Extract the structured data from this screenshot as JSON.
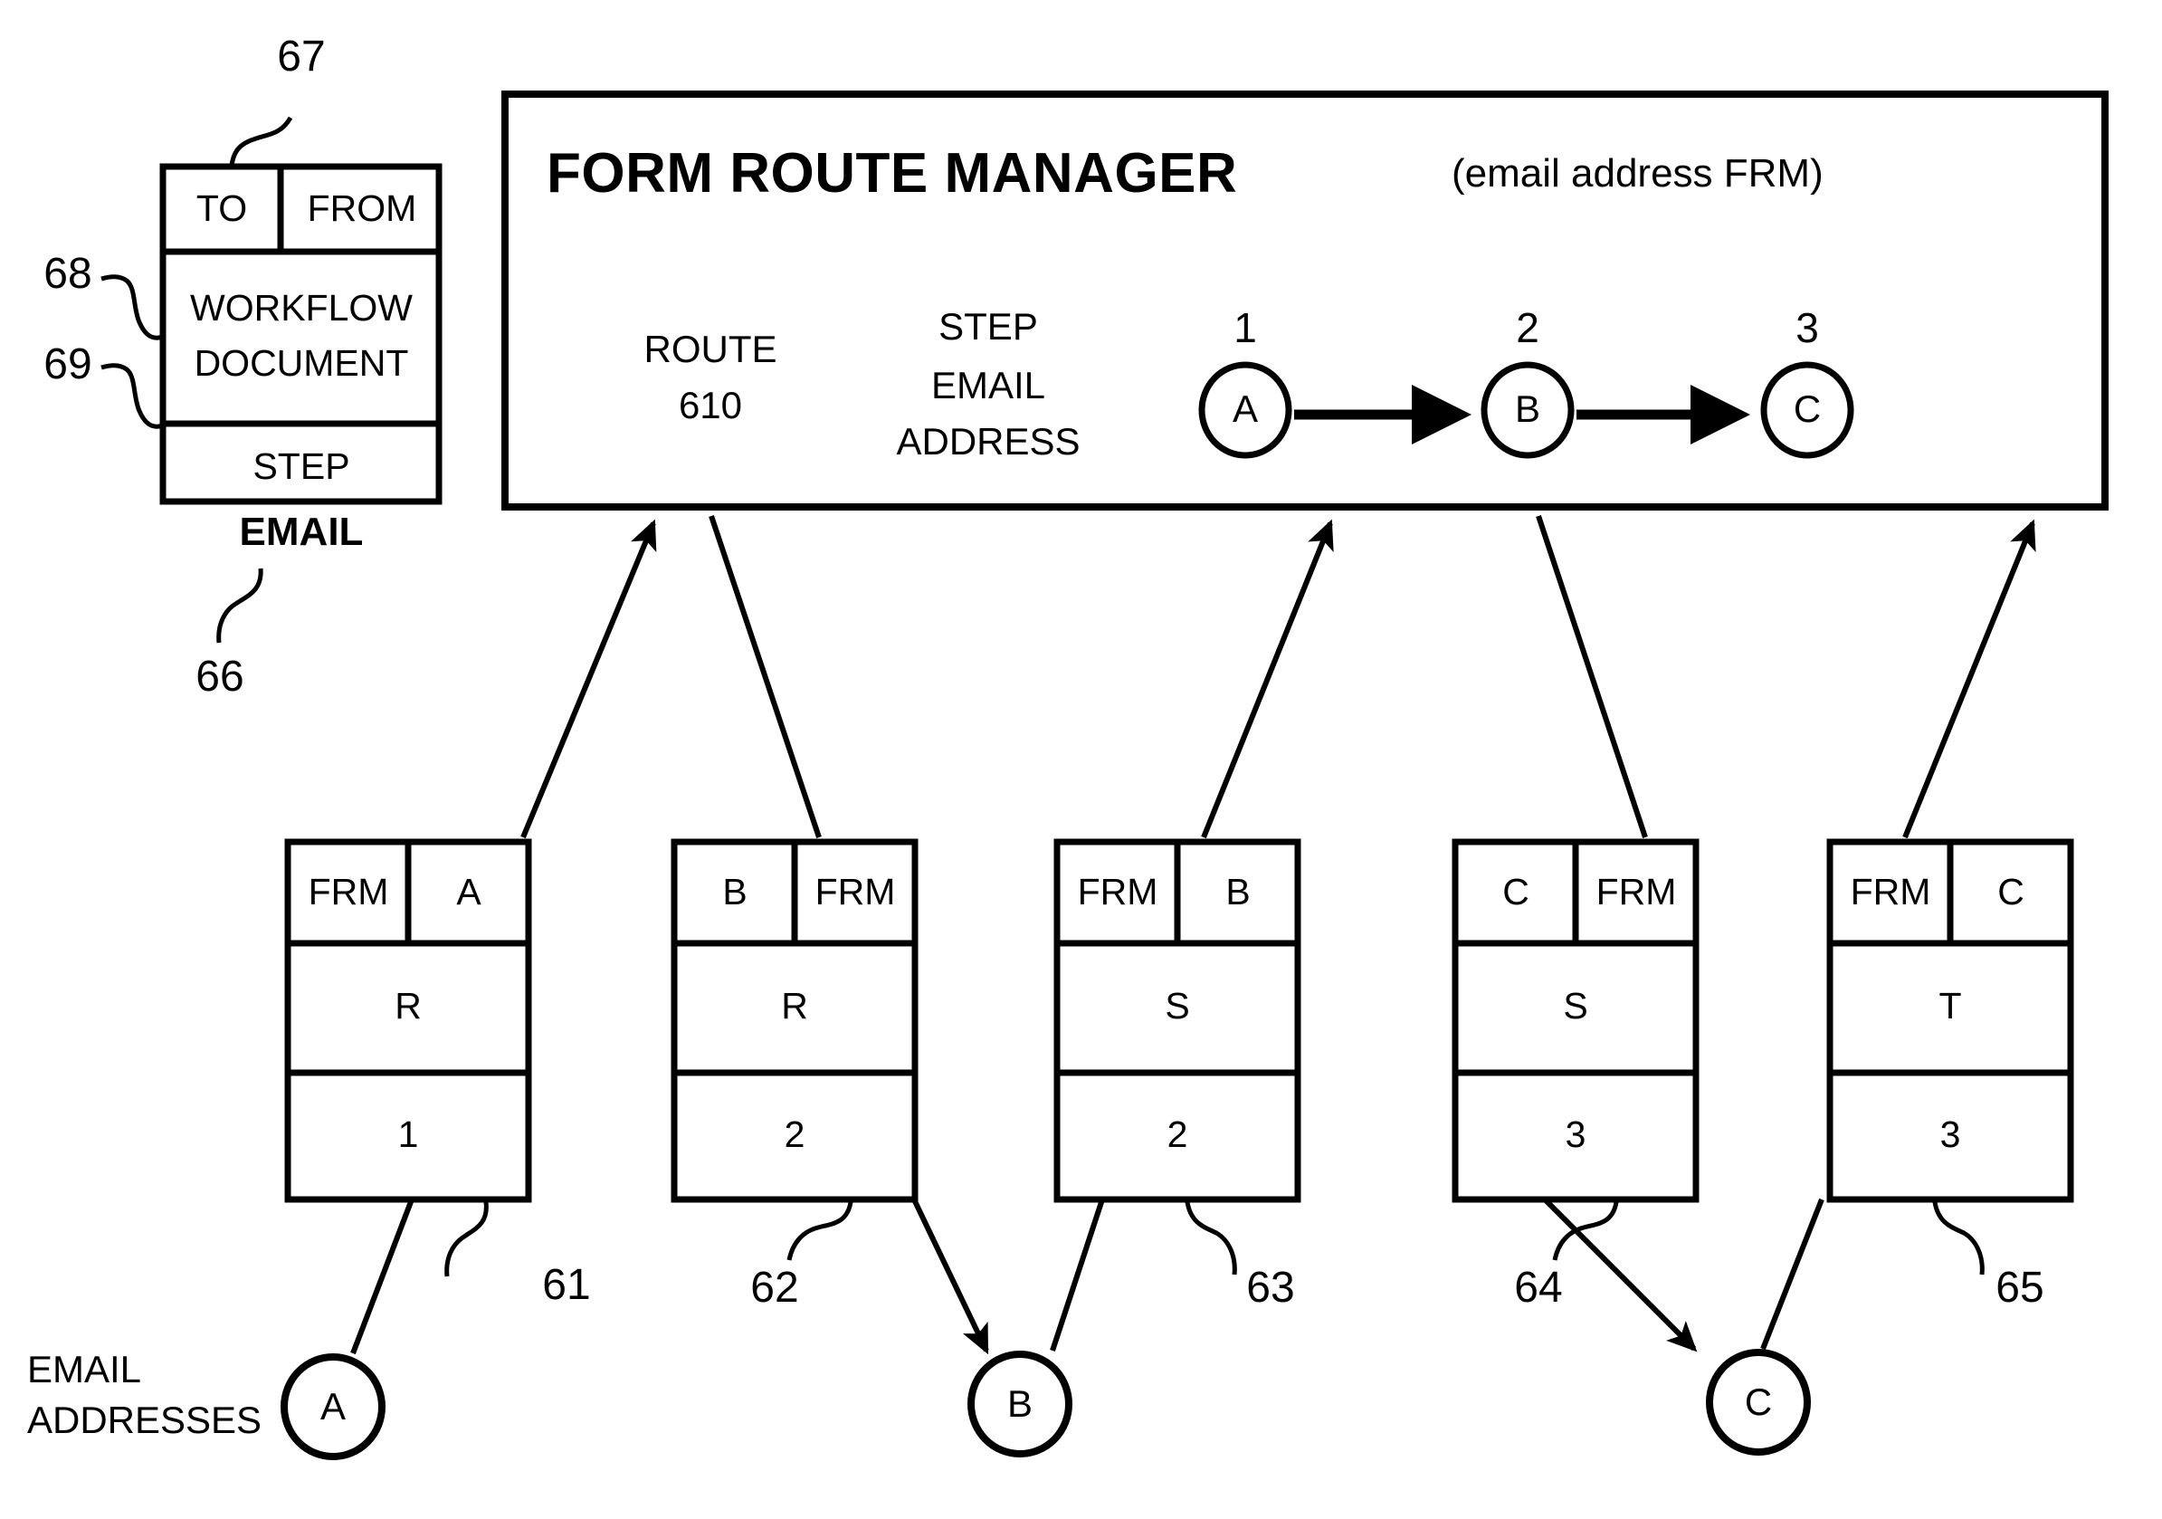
{
  "figure": {
    "email_message": {
      "ref_header": "67",
      "ref_body": "68",
      "ref_step": "69",
      "ref_whole": "66",
      "caption": "EMAIL",
      "to_label": "TO",
      "from_label": "FROM",
      "body_line1": "WORKFLOW",
      "body_line2": "DOCUMENT",
      "step_label": "STEP"
    },
    "frm_panel": {
      "title": "FORM ROUTE MANAGER",
      "subtitle": "(email address FRM)",
      "route_label_line1": "ROUTE",
      "route_label_line2": "610",
      "step_label_line1": "STEP",
      "step_label_line2": "EMAIL",
      "step_label_line3": "ADDRESS",
      "steps": [
        {
          "number": "1",
          "address": "A"
        },
        {
          "number": "2",
          "address": "B"
        },
        {
          "number": "3",
          "address": "C"
        }
      ]
    },
    "messages": [
      {
        "ref": "61",
        "to": "FRM",
        "from": "A",
        "route": "R",
        "step": "1"
      },
      {
        "ref": "62",
        "to": "B",
        "from": "FRM",
        "route": "R",
        "step": "2"
      },
      {
        "ref": "63",
        "to": "FRM",
        "from": "B",
        "route": "S",
        "step": "2"
      },
      {
        "ref": "64",
        "to": "C",
        "from": "FRM",
        "route": "S",
        "step": "3"
      },
      {
        "ref": "65",
        "to": "FRM",
        "from": "C",
        "route": "T",
        "step": "3"
      }
    ],
    "email_addresses": {
      "caption_line1": "EMAIL",
      "caption_line2": "ADDRESSES",
      "nodes": [
        "A",
        "B",
        "C"
      ]
    }
  },
  "colors": {
    "ink": "#000000",
    "paper": "#ffffff"
  }
}
